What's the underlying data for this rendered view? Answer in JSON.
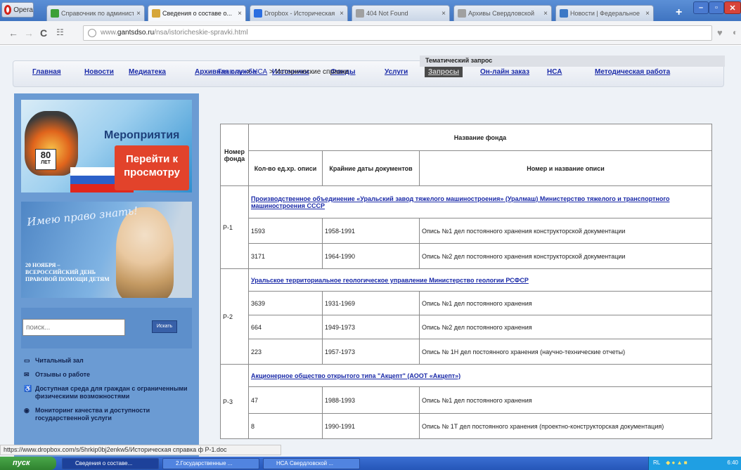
{
  "browser": {
    "opera_label": "Opera",
    "tabs": [
      {
        "label": "Справочник по администр",
        "color": "#3ca036"
      },
      {
        "label": "Сведения о составе о...",
        "color": "#d6a63a"
      },
      {
        "label": "Dropbox - Историческая",
        "color": "#2b6ee0"
      },
      {
        "label": "404 Not Found",
        "color": "#a0a0a0"
      },
      {
        "label": "Архивы Свердловской",
        "color": "#a0a0a0"
      },
      {
        "label": "Новости | Федеральное",
        "color": "#3b78c6"
      }
    ],
    "close_glyph": "×",
    "newtab_glyph": "+",
    "url_prefix": "www.",
    "url_domain": "gantsdso.ru",
    "url_path": "/nsa/istoricheskie-spravki.html"
  },
  "menu": {
    "items": [
      "Главная",
      "Новости",
      "Медиатека",
      "Архивная служба",
      "Источники",
      "Фонды",
      "Услуги",
      "Запросы",
      "Он-лайн заказ",
      "НСА",
      "Методическая работа"
    ],
    "active_index": 7,
    "submenu": "Тематический запрос"
  },
  "sidebar": {
    "banner1": {
      "title": "Мероприятия",
      "button": "Перейти к просмотру",
      "badge_num": "80",
      "badge_sub": "ЛЕТ"
    },
    "banner2": {
      "handwriting": "Имею право знать!",
      "caption": "20 НОЯБРЯ – ВСЕРОССИЙСКИЙ ДЕНЬ ПРАВОВОЙ ПОМОЩИ ДЕТЯМ"
    },
    "search": {
      "placeholder": "поиск...",
      "button": "Искать"
    },
    "links": [
      {
        "label": "Читальный зал",
        "icon": "▭"
      },
      {
        "label": "Отзывы о работе",
        "icon": "✉"
      },
      {
        "label": "Доступная среда для граждан с ограниченными физическими возможностями",
        "icon": "♿"
      },
      {
        "label": "Мониторинг качества и доступности государственной услуги",
        "icon": "◉"
      }
    ]
  },
  "breadcrumb": {
    "home_icon": "⌂",
    "items": [
      "Главная",
      "НСА",
      "Исторические справки"
    ],
    "sep": ">"
  },
  "table": {
    "h_fond_no": "Номер фонда",
    "h_fond_name": "Название фонда",
    "h_count": "Кол-во ед.хр. описи",
    "h_dates": "Крайние даты документов",
    "h_opis": "Номер и название описи",
    "groups": [
      {
        "code": "Р-1",
        "name": "Производственное объединение «Уральский завод тяжелого машиностроения» (Уралмаш) Министерство тяжелого и транспортного машиностроения СССР",
        "rows": [
          {
            "count": "1593",
            "dates": "1958-1991",
            "opis": "Опись №1 дел постоянного хранения конструкторской документации"
          },
          {
            "count": "3171",
            "dates": "1964-1990",
            "opis": "Опись №2 дел постоянного хранения конструкторской документации"
          }
        ]
      },
      {
        "code": "Р-2",
        "name": "Уральское территориальное геологическое управление Министерство геологии РСФСР",
        "rows": [
          {
            "count": "3639",
            "dates": "1931-1969",
            "opis": "Опись №1 дел постоянного хранения"
          },
          {
            "count": "664",
            "dates": "1949-1973",
            "opis": "Опись №2 дел постоянного хранения"
          },
          {
            "count": "223",
            "dates": "1957-1973",
            "opis": "Опись № 1Н дел постоянного хранения (научно-технические отчеты)"
          }
        ]
      },
      {
        "code": "Р-3",
        "name": "Акционерное общество открытого типа \"Акцепт\" (АООТ «Акцепт»)",
        "rows": [
          {
            "count": "47",
            "dates": "1988-1993",
            "opis": "Опись №1 дел постоянного хранения"
          },
          {
            "count": "8",
            "dates": "1990-1991",
            "opis": "Опись № 1Т дел постоянного хранения (проектно-конструкторская документация)"
          }
        ]
      }
    ]
  },
  "status_url": "https://www.dropbox.com/s/5hrkip0bj2enkw5/Историческая справка ф Р-1.doc",
  "taskbar": {
    "start": "пуск",
    "tasks": [
      "Сведения о составе...",
      "2.Государственные ...",
      "НСА Свердловской ..."
    ],
    "tray_lang": "RL",
    "tray_time": "6:40"
  }
}
